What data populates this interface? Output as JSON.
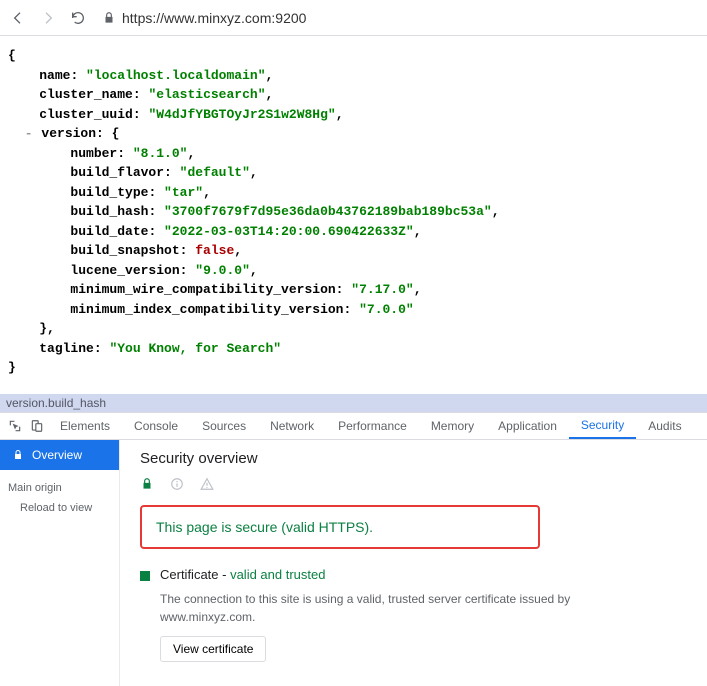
{
  "toolbar": {
    "url_scheme": "https://",
    "url_host": "www.minxyz.com",
    "url_port": ":9200"
  },
  "json": {
    "name": "localhost.localdomain",
    "cluster_name": "elasticsearch",
    "cluster_uuid": "W4dJfYBGTOyJr2S1w2W8Hg",
    "version": {
      "number": "8.1.0",
      "build_flavor": "default",
      "build_type": "tar",
      "build_hash": "3700f7679f7d95e36da0b43762189bab189bc53a",
      "build_date": "2022-03-03T14:20:00.690422633Z",
      "build_snapshot": "false",
      "lucene_version": "9.0.0",
      "minimum_wire_compatibility_version": "7.17.0",
      "minimum_index_compatibility_version": "7.0.0"
    },
    "tagline": "You Know, for Search"
  },
  "crumb": "version.build_hash",
  "devtabs": {
    "elements": "Elements",
    "console": "Console",
    "sources": "Sources",
    "network": "Network",
    "performance": "Performance",
    "memory": "Memory",
    "application": "Application",
    "security": "Security",
    "audits": "Audits"
  },
  "security": {
    "overview_pill": "Overview",
    "side_heading": "Main origin",
    "side_item": "Reload to view",
    "title": "Security overview",
    "secure_msg": "This page is secure (valid HTTPS).",
    "cert_label_prefix": "Certificate - ",
    "cert_label_status": "valid and trusted",
    "cert_desc": "The connection to this site is using a valid, trusted server certificate issued by www.minxyz.com.",
    "view_cert_btn": "View certificate"
  }
}
